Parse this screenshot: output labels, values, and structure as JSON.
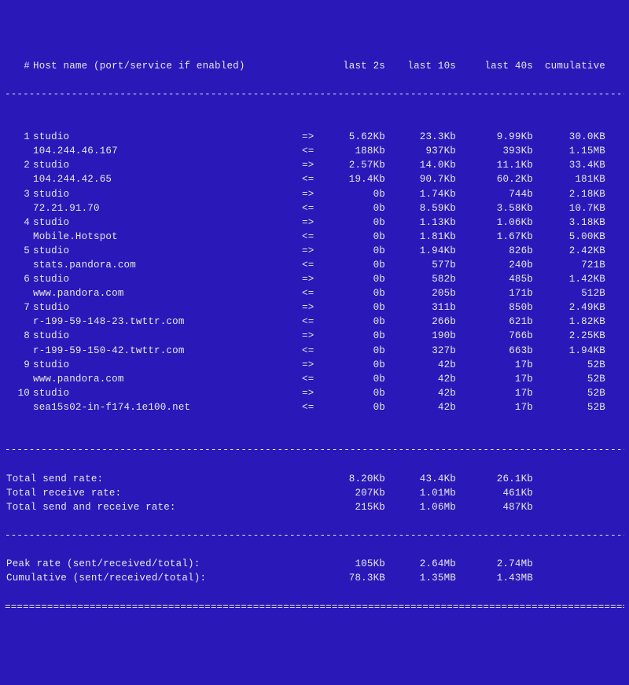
{
  "header": {
    "num": "#",
    "host": "Host name (port/service if enabled)",
    "last2": "last 2s",
    "last10": "last 10s",
    "last40": "last 40s",
    "cum": "cumulative"
  },
  "arrows": {
    "out": "=>",
    "in": "<="
  },
  "connections": [
    {
      "idx": "1",
      "local": "studio",
      "remote": "104.244.46.167",
      "out": {
        "l2": "5.62Kb",
        "l10": "23.3Kb",
        "l40": "9.99Kb",
        "cum": "30.0KB"
      },
      "in": {
        "l2": "188Kb",
        "l10": "937Kb",
        "l40": "393Kb",
        "cum": "1.15MB"
      }
    },
    {
      "idx": "2",
      "local": "studio",
      "remote": "104.244.42.65",
      "out": {
        "l2": "2.57Kb",
        "l10": "14.0Kb",
        "l40": "11.1Kb",
        "cum": "33.4KB"
      },
      "in": {
        "l2": "19.4Kb",
        "l10": "90.7Kb",
        "l40": "60.2Kb",
        "cum": "181KB"
      }
    },
    {
      "idx": "3",
      "local": "studio",
      "remote": "72.21.91.70",
      "out": {
        "l2": "0b",
        "l10": "1.74Kb",
        "l40": "744b",
        "cum": "2.18KB"
      },
      "in": {
        "l2": "0b",
        "l10": "8.59Kb",
        "l40": "3.58Kb",
        "cum": "10.7KB"
      }
    },
    {
      "idx": "4",
      "local": "studio",
      "remote": "Mobile.Hotspot",
      "out": {
        "l2": "0b",
        "l10": "1.13Kb",
        "l40": "1.06Kb",
        "cum": "3.18KB"
      },
      "in": {
        "l2": "0b",
        "l10": "1.81Kb",
        "l40": "1.67Kb",
        "cum": "5.00KB"
      }
    },
    {
      "idx": "5",
      "local": "studio",
      "remote": "stats.pandora.com",
      "out": {
        "l2": "0b",
        "l10": "1.94Kb",
        "l40": "826b",
        "cum": "2.42KB"
      },
      "in": {
        "l2": "0b",
        "l10": "577b",
        "l40": "240b",
        "cum": "721B"
      }
    },
    {
      "idx": "6",
      "local": "studio",
      "remote": "www.pandora.com",
      "out": {
        "l2": "0b",
        "l10": "582b",
        "l40": "485b",
        "cum": "1.42KB"
      },
      "in": {
        "l2": "0b",
        "l10": "205b",
        "l40": "171b",
        "cum": "512B"
      }
    },
    {
      "idx": "7",
      "local": "studio",
      "remote": "r-199-59-148-23.twttr.com",
      "out": {
        "l2": "0b",
        "l10": "311b",
        "l40": "850b",
        "cum": "2.49KB"
      },
      "in": {
        "l2": "0b",
        "l10": "266b",
        "l40": "621b",
        "cum": "1.82KB"
      }
    },
    {
      "idx": "8",
      "local": "studio",
      "remote": "r-199-59-150-42.twttr.com",
      "out": {
        "l2": "0b",
        "l10": "190b",
        "l40": "766b",
        "cum": "2.25KB"
      },
      "in": {
        "l2": "0b",
        "l10": "327b",
        "l40": "663b",
        "cum": "1.94KB"
      }
    },
    {
      "idx": "9",
      "local": "studio",
      "remote": "www.pandora.com",
      "out": {
        "l2": "0b",
        "l10": "42b",
        "l40": "17b",
        "cum": "52B"
      },
      "in": {
        "l2": "0b",
        "l10": "42b",
        "l40": "17b",
        "cum": "52B"
      }
    },
    {
      "idx": "10",
      "local": "studio",
      "remote": "sea15s02-in-f174.1e100.net",
      "out": {
        "l2": "0b",
        "l10": "42b",
        "l40": "17b",
        "cum": "52B"
      },
      "in": {
        "l2": "0b",
        "l10": "42b",
        "l40": "17b",
        "cum": "52B"
      }
    }
  ],
  "totals": [
    {
      "label": "Total send rate:",
      "v1": "8.20Kb",
      "v2": "43.4Kb",
      "v3": "26.1Kb",
      "v4": ""
    },
    {
      "label": "Total receive rate:",
      "v1": "207Kb",
      "v2": "1.01Mb",
      "v3": "461Kb",
      "v4": ""
    },
    {
      "label": "Total send and receive rate:",
      "v1": "215Kb",
      "v2": "1.06Mb",
      "v3": "487Kb",
      "v4": ""
    }
  ],
  "stats": [
    {
      "label": "Peak rate (sent/received/total):",
      "v1": "105Kb",
      "v2": "2.64Mb",
      "v3": "2.74Mb",
      "v4": ""
    },
    {
      "label": "Cumulative (sent/received/total):",
      "v1": "78.3KB",
      "v2": "1.35MB",
      "v3": "1.43MB",
      "v4": ""
    }
  ],
  "separators": {
    "dash": "--------------------------------------------------------------------------------------------------------",
    "equals": "========================================================================================================"
  }
}
